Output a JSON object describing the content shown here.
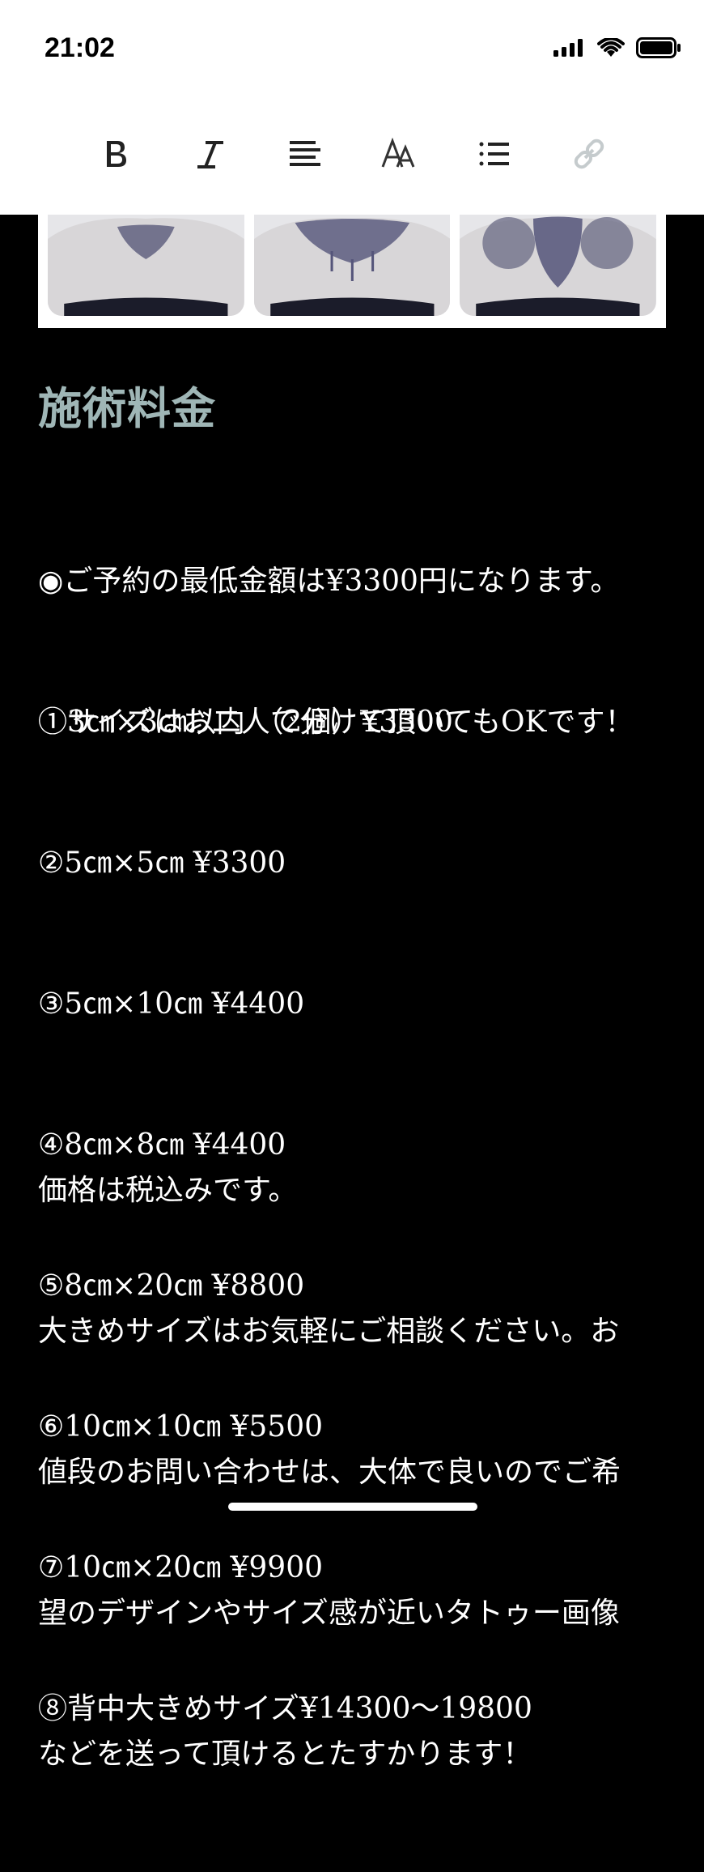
{
  "status_bar": {
    "time": "21:02"
  },
  "toolbar": {
    "tools": [
      {
        "name": "bold",
        "icon": "bold-icon"
      },
      {
        "name": "italic",
        "icon": "italic-icon"
      },
      {
        "name": "align",
        "icon": "align-left-icon"
      },
      {
        "name": "font-size",
        "icon": "text-size-icon"
      },
      {
        "name": "list",
        "icon": "list-icon"
      },
      {
        "name": "link",
        "icon": "link-icon",
        "disabled": true
      }
    ]
  },
  "content": {
    "heading": "施術料金",
    "intro_lines": [
      "◉ご予約の最低金額は¥3300円になります。",
      "①サイズはお二人で分けて頂いてもOKです！"
    ],
    "price_list": [
      "①3㎝×3㎝以内 （2個）¥3300",
      "②5㎝×5㎝ ¥3300",
      "③5㎝×10㎝ ¥4400",
      "④8㎝×8㎝ ¥4400",
      "⑤8㎝×20㎝ ¥8800",
      "⑥10㎝×10㎝ ¥5500",
      "⑦10㎝×20㎝ ¥9900",
      "⑧背中大きめサイズ¥14300〜19800"
    ],
    "notes": [
      "価格は税込みです。",
      "大きめサイズはお気軽にご相談ください。お",
      "値段のお問い合わせは、大体で良いのでご希",
      "望のデザインやサイズ感が近いタトゥー画像",
      "などを送って頂けるとたすかります！"
    ]
  },
  "colors": {
    "heading": "#9fb6b6",
    "background": "#000000",
    "text": "#ffffff"
  }
}
